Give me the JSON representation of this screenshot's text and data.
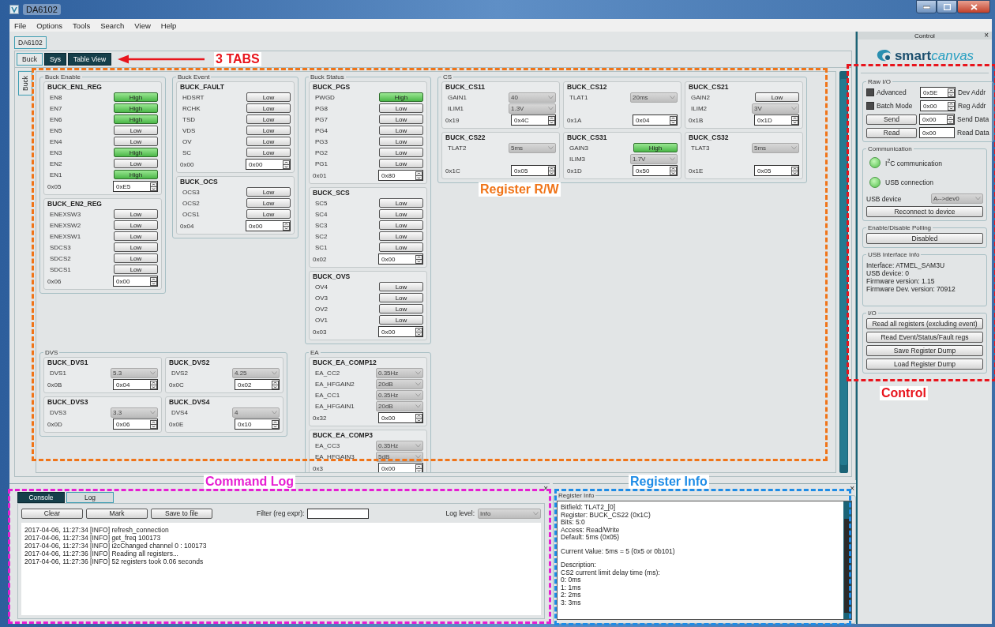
{
  "window": {
    "title": "DA6102"
  },
  "menu": [
    "File",
    "Options",
    "Tools",
    "Search",
    "View",
    "Help"
  ],
  "document_tab": {
    "label": "DA6102",
    "selected": true
  },
  "tabs": [
    {
      "label": "Buck",
      "selected": true
    },
    {
      "label": "Sys",
      "selected": false
    },
    {
      "label": "Table View",
      "selected": false
    }
  ],
  "tabs_annotation": {
    "label": "3 TABS",
    "color": "#e8141c"
  },
  "side_tabs": [
    {
      "label": "Buck",
      "selected": true
    }
  ],
  "canvas": {
    "annotation": {
      "label": "Register R/W",
      "color": "#f07418"
    },
    "groups": [
      {
        "title": "Buck Enable",
        "rows": [
          [
            {
              "name": "BUCK_EN1_REG",
              "address": "0x05",
              "value": "0xE5",
              "fields": [
                {
                  "kind": "toggle",
                  "label": "EN8",
                  "value": "High",
                  "on": true
                },
                {
                  "kind": "toggle",
                  "label": "EN7",
                  "value": "High",
                  "on": true
                },
                {
                  "kind": "toggle",
                  "label": "EN6",
                  "value": "High",
                  "on": true
                },
                {
                  "kind": "toggle",
                  "label": "EN5",
                  "value": "Low",
                  "on": false
                },
                {
                  "kind": "toggle",
                  "label": "EN4",
                  "value": "Low",
                  "on": false
                },
                {
                  "kind": "toggle",
                  "label": "EN3",
                  "value": "High",
                  "on": true
                },
                {
                  "kind": "toggle",
                  "label": "EN2",
                  "value": "Low",
                  "on": false
                },
                {
                  "kind": "toggle",
                  "label": "EN1",
                  "value": "High",
                  "on": true
                }
              ]
            }
          ],
          [
            {
              "name": "BUCK_EN2_REG",
              "address": "0x06",
              "value": "0x00",
              "fields": [
                {
                  "kind": "toggle",
                  "label": "ENEXSW3",
                  "value": "Low",
                  "on": false
                },
                {
                  "kind": "toggle",
                  "label": "ENEXSW2",
                  "value": "Low",
                  "on": false
                },
                {
                  "kind": "toggle",
                  "label": "ENEXSW1",
                  "value": "Low",
                  "on": false
                },
                {
                  "kind": "toggle",
                  "label": "SDCS3",
                  "value": "Low",
                  "on": false
                },
                {
                  "kind": "toggle",
                  "label": "SDCS2",
                  "value": "Low",
                  "on": false
                },
                {
                  "kind": "toggle",
                  "label": "SDCS1",
                  "value": "Low",
                  "on": false
                }
              ]
            }
          ]
        ]
      },
      {
        "title": "Buck Event",
        "rows": [
          [
            {
              "name": "BUCK_FAULT",
              "address": "0x00",
              "value": "0x00",
              "fields": [
                {
                  "kind": "toggle",
                  "label": "HDSRT",
                  "value": "Low",
                  "on": false
                },
                {
                  "kind": "toggle",
                  "label": "RCHK",
                  "value": "Low",
                  "on": false
                },
                {
                  "kind": "toggle",
                  "label": "TSD",
                  "value": "Low",
                  "on": false
                },
                {
                  "kind": "toggle",
                  "label": "VDS",
                  "value": "Low",
                  "on": false
                },
                {
                  "kind": "toggle",
                  "label": "OV",
                  "value": "Low",
                  "on": false
                },
                {
                  "kind": "toggle",
                  "label": "SC",
                  "value": "Low",
                  "on": false
                }
              ]
            }
          ],
          [
            {
              "name": "BUCK_OCS",
              "address": "0x04",
              "value": "0x00",
              "fields": [
                {
                  "kind": "toggle",
                  "label": "OCS3",
                  "value": "Low",
                  "on": false
                },
                {
                  "kind": "toggle",
                  "label": "OCS2",
                  "value": "Low",
                  "on": false
                },
                {
                  "kind": "toggle",
                  "label": "OCS1",
                  "value": "Low",
                  "on": false
                }
              ]
            }
          ]
        ]
      },
      {
        "title": "Buck Status",
        "rows": [
          [
            {
              "name": "BUCK_PGS",
              "address": "0x01",
              "value": "0x80",
              "fields": [
                {
                  "kind": "toggle",
                  "label": "PWGD",
                  "value": "High",
                  "on": true
                },
                {
                  "kind": "toggle",
                  "label": "PG8",
                  "value": "Low",
                  "on": false
                },
                {
                  "kind": "toggle",
                  "label": "PG7",
                  "value": "Low",
                  "on": false
                },
                {
                  "kind": "toggle",
                  "label": "PG4",
                  "value": "Low",
                  "on": false
                },
                {
                  "kind": "toggle",
                  "label": "PG3",
                  "value": "Low",
                  "on": false
                },
                {
                  "kind": "toggle",
                  "label": "PG2",
                  "value": "Low",
                  "on": false
                },
                {
                  "kind": "toggle",
                  "label": "PG1",
                  "value": "Low",
                  "on": false
                }
              ]
            }
          ],
          [
            {
              "name": "BUCK_SCS",
              "address": "0x02",
              "value": "0x00",
              "fields": [
                {
                  "kind": "toggle",
                  "label": "SC5",
                  "value": "Low",
                  "on": false
                },
                {
                  "kind": "toggle",
                  "label": "SC4",
                  "value": "Low",
                  "on": false
                },
                {
                  "kind": "toggle",
                  "label": "SC3",
                  "value": "Low",
                  "on": false
                },
                {
                  "kind": "toggle",
                  "label": "SC2",
                  "value": "Low",
                  "on": false
                },
                {
                  "kind": "toggle",
                  "label": "SC1",
                  "value": "Low",
                  "on": false
                }
              ]
            }
          ],
          [
            {
              "name": "BUCK_OVS",
              "address": "0x03",
              "value": "0x00",
              "fields": [
                {
                  "kind": "toggle",
                  "label": "OV4",
                  "value": "Low",
                  "on": false
                },
                {
                  "kind": "toggle",
                  "label": "OV3",
                  "value": "Low",
                  "on": false
                },
                {
                  "kind": "toggle",
                  "label": "OV2",
                  "value": "Low",
                  "on": false
                },
                {
                  "kind": "toggle",
                  "label": "OV1",
                  "value": "Low",
                  "on": false
                }
              ]
            }
          ]
        ]
      },
      {
        "title": "CS",
        "rows": [
          [
            {
              "name": "BUCK_CS11",
              "address": "0x19",
              "value": "0x4C",
              "fields": [
                {
                  "kind": "combo",
                  "label": "GAIN1",
                  "value": "40"
                },
                {
                  "kind": "combo",
                  "label": "ILIM1",
                  "value": "1.3V"
                }
              ]
            },
            {
              "name": "BUCK_CS12",
              "address": "0x1A",
              "value": "0x04",
              "fields": [
                {
                  "kind": "combo",
                  "label": "TLAT1",
                  "value": "20ms"
                }
              ]
            },
            {
              "name": "BUCK_CS21",
              "address": "0x1B",
              "value": "0x1D",
              "fields": [
                {
                  "kind": "toggle",
                  "label": "GAIN2",
                  "value": "Low",
                  "on": false
                },
                {
                  "kind": "combo",
                  "label": "ILIM2",
                  "value": "3V"
                }
              ]
            }
          ],
          [
            {
              "name": "BUCK_CS22",
              "address": "0x1C",
              "value": "0x05",
              "fields": [
                {
                  "kind": "combo",
                  "label": "TLAT2",
                  "value": "5ms"
                }
              ]
            },
            {
              "name": "BUCK_CS31",
              "address": "0x1D",
              "value": "0x50",
              "fields": [
                {
                  "kind": "toggle",
                  "label": "GAIN3",
                  "value": "High",
                  "on": true
                },
                {
                  "kind": "combo",
                  "label": "ILIM3",
                  "value": "1.7V"
                }
              ]
            },
            {
              "name": "BUCK_CS32",
              "address": "0x1E",
              "value": "0x05",
              "fields": [
                {
                  "kind": "combo",
                  "label": "TLAT3",
                  "value": "5ms"
                }
              ]
            }
          ]
        ]
      },
      {
        "title": "DVS",
        "rows": [
          [
            {
              "name": "BUCK_DVS1",
              "address": "0x0B",
              "value": "0x04",
              "fields": [
                {
                  "kind": "combo",
                  "label": "DVS1",
                  "value": "5.3"
                }
              ]
            },
            {
              "name": "BUCK_DVS2",
              "address": "0x0C",
              "value": "0x02",
              "fields": [
                {
                  "kind": "combo",
                  "label": "DVS2",
                  "value": "4.25"
                }
              ]
            }
          ],
          [
            {
              "name": "BUCK_DVS3",
              "address": "0x0D",
              "value": "0x06",
              "fields": [
                {
                  "kind": "combo",
                  "label": "DVS3",
                  "value": "3.3"
                }
              ]
            },
            {
              "name": "BUCK_DVS4",
              "address": "0x0E",
              "value": "0x10",
              "fields": [
                {
                  "kind": "combo",
                  "label": "DVS4",
                  "value": "4"
                }
              ]
            }
          ]
        ]
      },
      {
        "title": "EA",
        "rows": [
          [
            {
              "name": "BUCK_EA_COMP12",
              "address": "0x32",
              "value": "0x00",
              "fields": [
                {
                  "kind": "combo",
                  "label": "EA_CC2",
                  "value": "0.35Hz"
                },
                {
                  "kind": "combo",
                  "label": "EA_HFGAIN2",
                  "value": "20dB"
                },
                {
                  "kind": "combo",
                  "label": "EA_CC1",
                  "value": "0.35Hz"
                },
                {
                  "kind": "combo",
                  "label": "EA_HFGAIN1",
                  "value": "20dB"
                }
              ]
            }
          ],
          [
            {
              "name": "BUCK_EA_COMP3",
              "address": "0x3",
              "value": "0x00",
              "fields": [
                {
                  "kind": "combo",
                  "label": "EA_CC3",
                  "value": "0.35Hz"
                },
                {
                  "kind": "combo",
                  "label": "EA_HFGAIN3",
                  "value": "5dB"
                }
              ]
            }
          ]
        ]
      }
    ]
  },
  "control": {
    "title": "Control",
    "close_label": "×",
    "logo": {
      "text_1": "smart",
      "text_2": "canvas"
    },
    "annotation": {
      "label": "Control",
      "color": "#e8141c"
    },
    "raw_io": {
      "title": "Raw I/O",
      "rows": [
        {
          "kind": "checkbox",
          "label": "Advanced",
          "checked": false,
          "value": "0x5E",
          "caption": "Dev Addr"
        },
        {
          "kind": "checkbox",
          "label": "Batch Mode",
          "checked": false,
          "value": "0x00",
          "caption": "Reg Addr"
        },
        {
          "kind": "button",
          "label": "Send",
          "value": "0x00",
          "caption": "Send Data"
        },
        {
          "kind": "readout",
          "label": "Read",
          "value": "0x00",
          "caption": "Read Data"
        }
      ]
    },
    "communication": {
      "title": "Communication",
      "indicators": [
        {
          "label": "I$^{2}$C communication",
          "on": true
        },
        {
          "label": "USB connection",
          "on": true
        }
      ],
      "device_label": "USB device",
      "device": "A-->dev0",
      "button": "Reconnect to device"
    },
    "polling": {
      "title": "Enable/Disable Polling",
      "button": "Disabled"
    },
    "usb_info": {
      "title": "USB Interface Info",
      "lines": [
        "Interface: ATMEL_SAM3U",
        "USB device: 0",
        "Firmware version: 1.15",
        "Firmware Dev. version: 70912"
      ]
    },
    "io": {
      "title": "I/O",
      "buttons": [
        "Read all registers (excluding event)",
        "Read Event/Status/Fault regs",
        "Save Register Dump",
        "Load Register Dump"
      ]
    }
  },
  "log_panel": {
    "close_label": "×",
    "annotation": {
      "label": "Command Log",
      "color": "#e61ed2"
    },
    "tabs": [
      {
        "label": "Console",
        "selected": false
      },
      {
        "label": "Log",
        "selected": true
      }
    ],
    "buttons": [
      "Clear",
      "Mark",
      "Save to file"
    ],
    "filter_label": "Filter (reg expr):",
    "log_level_label": "Log level:",
    "log_level": "Info",
    "lines": [
      "2017-04-06, 11:27:34 [INFO] refresh_connection",
      "2017-04-06, 11:27:34 [INFO] get_freq 100173",
      "2017-04-06, 11:27:34 [INFO] i2cChanged channel 0 : 100173",
      "2017-04-06, 11:27:36 [INFO] Reading all registers...",
      "2017-04-06, 11:27:36 [INFO] 52 registers took 0.06 seconds"
    ]
  },
  "info_panel": {
    "close_label": "×",
    "annotation": {
      "label": "Register Info",
      "color": "#1e8ce6"
    },
    "group_title": "Register Info",
    "paragraphs": [
      [
        "Bitfield: TLAT2_[0]",
        "Register: BUCK_CS22 (0x1C)",
        "Bits: 5:0",
        "Access: Read/Write",
        "Default: 5ms (0x05)"
      ],
      [
        "Current Value: 5ms = 5 (0x5 or 0b101)"
      ],
      [
        "Description:",
        "CS2 current limit delay time (ms):",
        "0: 0ms",
        "1: 1ms",
        "2: 2ms",
        "3: 3ms"
      ]
    ]
  }
}
